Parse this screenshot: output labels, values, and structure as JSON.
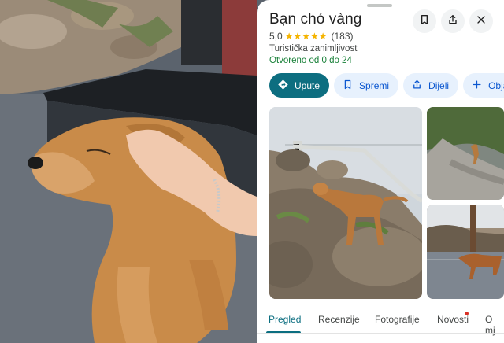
{
  "place": {
    "title": "Bạn chó vàng",
    "rating": "5,0",
    "stars": 5,
    "review_count": "(183)",
    "category": "Turistička zanimljivost",
    "open_status": "Otvoreno od 0 do 24"
  },
  "actions": {
    "directions": "Upute",
    "save": "Spremi",
    "share": "Dijeli",
    "more": "Obja"
  },
  "tabs": [
    "Pregled",
    "Recenzije",
    "Fotografije",
    "Novosti",
    "O mj"
  ],
  "active_tab": "Pregled",
  "colors": {
    "accent": "#0d6e80",
    "chip_bg": "#e7f1fd",
    "chip_text": "#0b57d0",
    "open_green": "#188038",
    "star": "#f5b400",
    "badge": "#d93025"
  },
  "icons": {
    "header": [
      "bookmark-icon",
      "share-icon",
      "close-icon"
    ],
    "chips": [
      "directions-icon",
      "bookmark-icon",
      "share-icon",
      "plus-icon"
    ]
  }
}
